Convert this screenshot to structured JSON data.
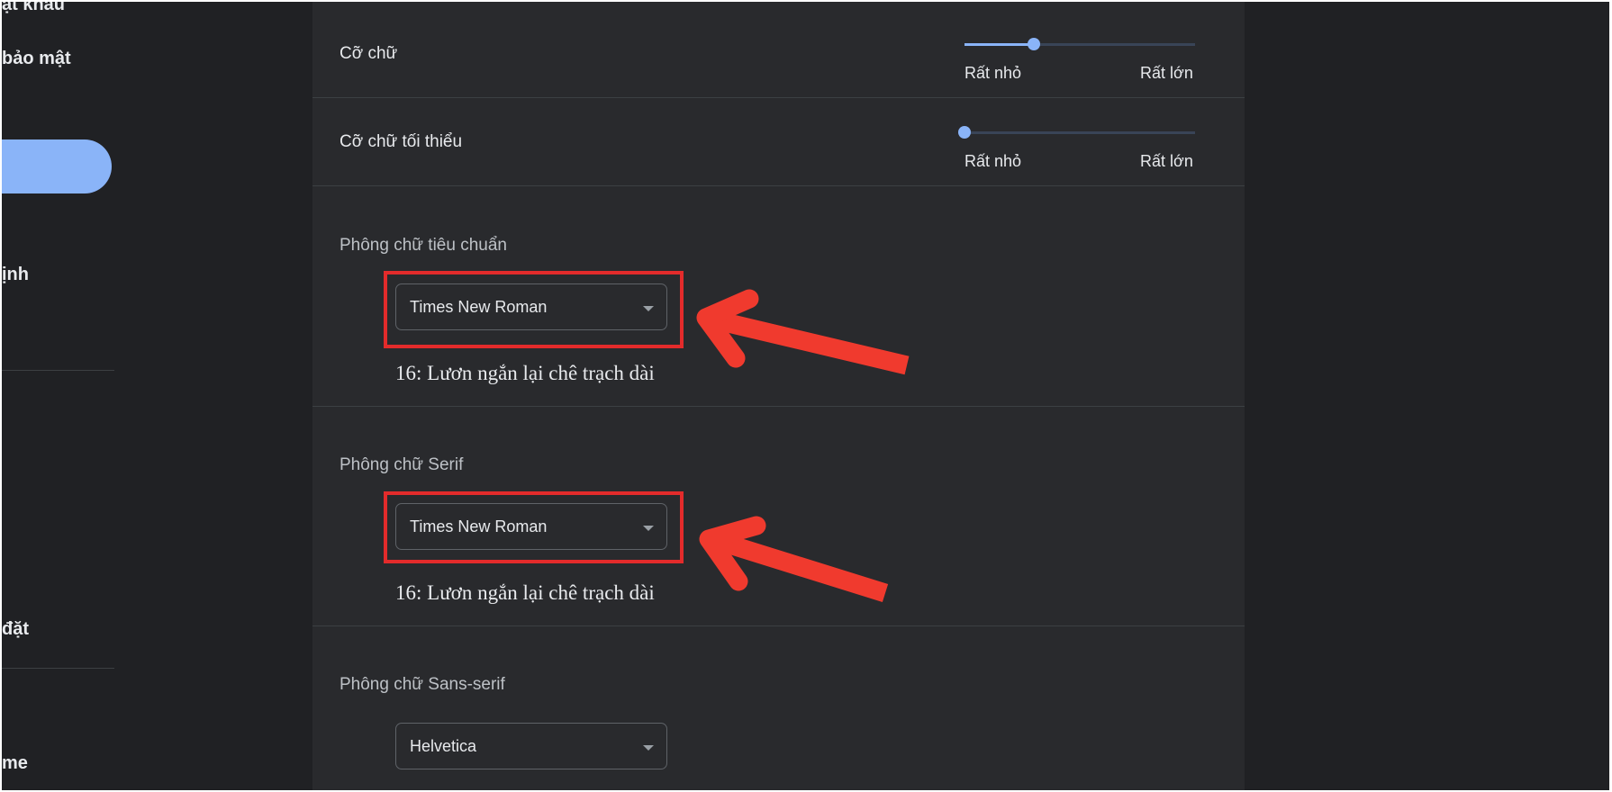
{
  "sidebar": {
    "items": [
      {
        "label": "ật khẩu"
      },
      {
        "label": "bảo mật"
      },
      {
        "label": "ịnh"
      },
      {
        "label": "đặt"
      },
      {
        "label": "me"
      }
    ]
  },
  "settings": {
    "font_size": {
      "label": "Cỡ chữ",
      "value": 0.3,
      "min_label": "Rất nhỏ",
      "max_label": "Rất lớn"
    },
    "min_font_size": {
      "label": "Cỡ chữ tối thiểu",
      "value": 0,
      "min_label": "Rất nhỏ",
      "max_label": "Rất lớn"
    },
    "standard_font": {
      "label": "Phông chữ tiêu chuẩn",
      "value": "Times New Roman",
      "sample": "16: Lươn ngắn lại chê trạch dài"
    },
    "serif_font": {
      "label": "Phông chữ Serif",
      "value": "Times New Roman",
      "sample": "16: Lươn ngắn lại chê trạch dài"
    },
    "sans_serif_font": {
      "label": "Phông chữ Sans-serif",
      "value": "Helvetica"
    }
  },
  "colors": {
    "accent": "#8ab4f8",
    "highlight": "#e32b2b",
    "panel_bg": "#292a2d",
    "page_bg": "#202124"
  }
}
